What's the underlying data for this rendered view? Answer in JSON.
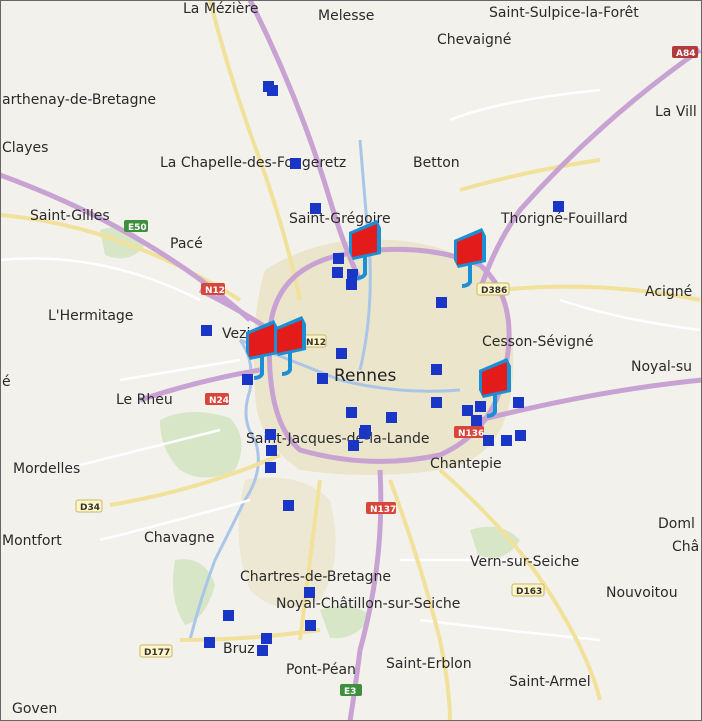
{
  "map": {
    "colors": {
      "background": "#f3f1ec",
      "urban": "#e9e3c9",
      "green": "#d3e4c3",
      "water": "#a9c6e6",
      "motorway": "#c9a3d3",
      "primary": "#f1e19a",
      "minor": "#ffffff",
      "marker_square": "#1a36c7",
      "pin_flag": "#e41b1b",
      "pin_pole": "#1a8fd6"
    },
    "towns": {
      "la_meziere": "La Mézière",
      "melesse": "Melesse",
      "saint_sulpice": "Saint-Sulpice-la-Forêt",
      "chevaigne": "Chevaigné",
      "parthenay": "arthenay-de-Bretagne",
      "la_ville": "La Vill",
      "clayes": "Clayes",
      "la_chapelle": "La Chapelle-des-Fougeretz",
      "betton": "Betton",
      "saint_gilles": "Saint-Gilles",
      "saint_gregoire": "Saint-Grégoire",
      "thorigne": "Thorigné-Fouillard",
      "pace": "Pacé",
      "acigne": "Acigné",
      "lhermitage": "L'Hermitage",
      "vezin": "Vezi",
      "cesson": "Cesson-Sévigné",
      "noyal_sur": "Noyal-su",
      "rennes": "Rennes",
      "le_rheu": "Le Rheu",
      "left_cut": "é",
      "saint_jacques": "Saint-Jacques-de-la-Lande",
      "chantepie": "Chantepie",
      "mordelles": "Mordelles",
      "montfort": "Montfort",
      "chavagne": "Chavagne",
      "domloup": "Doml",
      "chateaugiron": "Châ",
      "vern": "Vern-sur-Seiche",
      "nouvoitou": "Nouvoitou",
      "chartres": "Chartres-de-Bretagne",
      "noyal_chatillon": "Noyal-Châtillon-sur-Seiche",
      "bruz": "Bruz",
      "saint_erblon": "Saint-Erblon",
      "pont_pean": "Pont-Péan",
      "saint_armel": "Saint-Armel",
      "goven": "Goven"
    },
    "shields": {
      "a84": "A84",
      "e50": "E50",
      "n12": "N12",
      "d386": "D386",
      "n24": "N24",
      "n136": "N136",
      "d34": "D34",
      "n137": "N137",
      "d163": "D163",
      "d177": "D177",
      "e3": "E3",
      "n12b": "N12"
    },
    "markers": {
      "squares": [
        {
          "id": "sq-la-meziere-1"
        },
        {
          "id": "sq-la-meziere-2"
        },
        {
          "id": "sq-la-chapelle"
        },
        {
          "id": "sq-saint-gregoire"
        },
        {
          "id": "sq-thorigne"
        },
        {
          "id": "sq-north-rennes-1"
        },
        {
          "id": "sq-north-rennes-2"
        },
        {
          "id": "sq-north-rennes-3"
        },
        {
          "id": "sq-north-rennes-4"
        },
        {
          "id": "sq-east-rennes"
        },
        {
          "id": "sq-vezin"
        },
        {
          "id": "sq-west-rennes"
        },
        {
          "id": "sq-rennes-center-1"
        },
        {
          "id": "sq-rennes-center-2"
        },
        {
          "id": "sq-cesson-1"
        },
        {
          "id": "sq-south-rennes-1"
        },
        {
          "id": "sq-south-rennes-2"
        },
        {
          "id": "sq-south-rennes-3"
        },
        {
          "id": "sq-south-rennes-4"
        },
        {
          "id": "sq-south-rennes-5"
        },
        {
          "id": "sq-cesson-2"
        },
        {
          "id": "sq-chantepie-1"
        },
        {
          "id": "sq-chantepie-2"
        },
        {
          "id": "sq-chantepie-3"
        },
        {
          "id": "sq-chantepie-4"
        },
        {
          "id": "sq-chantepie-5"
        },
        {
          "id": "sq-chantepie-6"
        },
        {
          "id": "sq-chantepie-7"
        },
        {
          "id": "sq-saint-jacques-1"
        },
        {
          "id": "sq-saint-jacques-2"
        },
        {
          "id": "sq-saint-jacques-3"
        },
        {
          "id": "sq-airport"
        },
        {
          "id": "sq-chartres"
        },
        {
          "id": "sq-noyal-chatillon"
        },
        {
          "id": "sq-bruz-1"
        },
        {
          "id": "sq-bruz-2"
        },
        {
          "id": "sq-bruz-3"
        },
        {
          "id": "sq-bruz-4"
        }
      ],
      "pins": [
        {
          "id": "pin-saint-gregoire"
        },
        {
          "id": "pin-north-east"
        },
        {
          "id": "pin-vezin-1"
        },
        {
          "id": "pin-vezin-2"
        },
        {
          "id": "pin-cesson"
        }
      ]
    }
  }
}
